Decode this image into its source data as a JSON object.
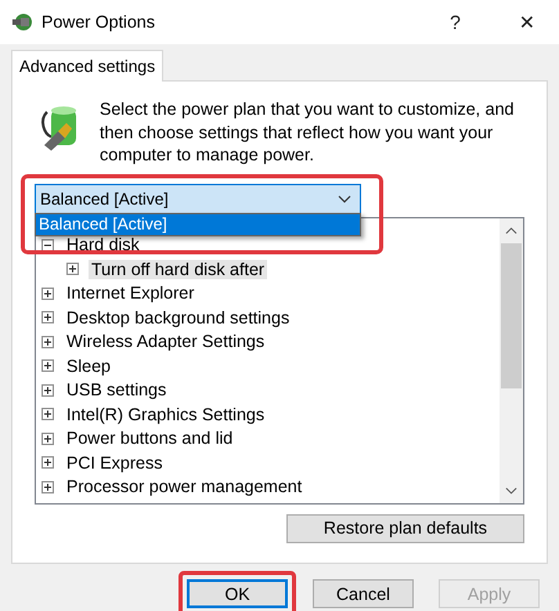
{
  "window": {
    "title": "Power Options",
    "help": "?",
    "close": "✕"
  },
  "tabs": [
    {
      "label": "Advanced settings",
      "selected": true
    }
  ],
  "intro": "Select the power plan that you want to customize, and then choose settings that reflect how you want your computer to manage power.",
  "plan_dropdown": {
    "value": "Balanced [Active]",
    "open": true,
    "highlighted": true,
    "options": [
      {
        "label": "Balanced [Active]",
        "selected": true
      }
    ]
  },
  "settings_tree": [
    {
      "label": "Hard disk",
      "expanded": true,
      "selected": false,
      "children": [
        {
          "label": "Turn off hard disk after",
          "expanded": false,
          "selected": true
        }
      ]
    },
    {
      "label": "Internet Explorer",
      "expanded": false,
      "selected": false
    },
    {
      "label": "Desktop background settings",
      "expanded": false,
      "selected": false
    },
    {
      "label": "Wireless Adapter Settings",
      "expanded": false,
      "selected": false
    },
    {
      "label": "Sleep",
      "expanded": false,
      "selected": false
    },
    {
      "label": "USB settings",
      "expanded": false,
      "selected": false
    },
    {
      "label": "Intel(R) Graphics Settings",
      "expanded": false,
      "selected": false
    },
    {
      "label": "Power buttons and lid",
      "expanded": false,
      "selected": false
    },
    {
      "label": "PCI Express",
      "expanded": false,
      "selected": false
    },
    {
      "label": "Processor power management",
      "expanded": false,
      "selected": false
    }
  ],
  "restore_button": "Restore plan defaults",
  "buttons": [
    {
      "label": "OK",
      "default": true,
      "highlighted": true,
      "disabled": false
    },
    {
      "label": "Cancel",
      "default": false,
      "highlighted": false,
      "disabled": false
    },
    {
      "label": "Apply",
      "default": false,
      "highlighted": false,
      "disabled": true
    }
  ]
}
